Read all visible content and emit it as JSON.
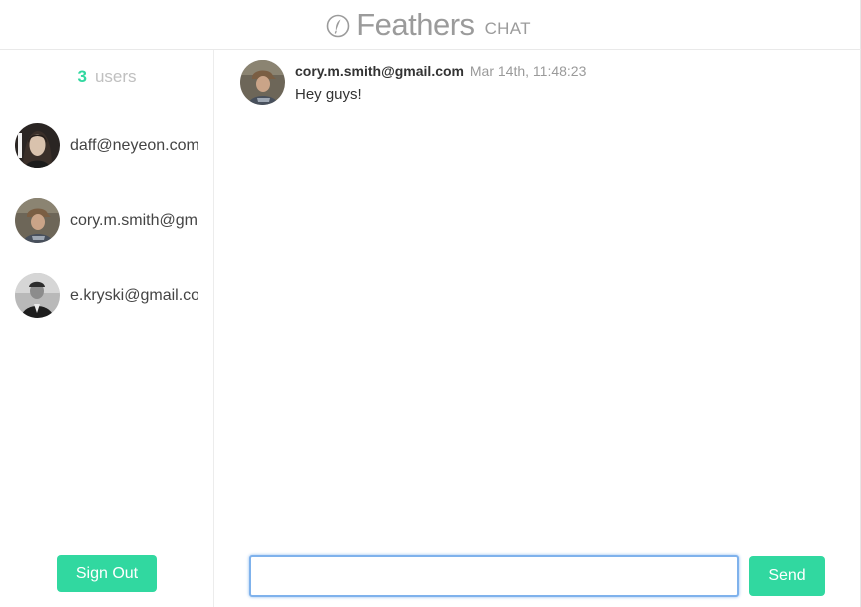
{
  "header": {
    "logo_icon": "feather-icon",
    "title": "Feathers",
    "subtitle": "CHAT"
  },
  "sidebar": {
    "user_count": "3",
    "user_count_label": "users",
    "users": [
      {
        "email": "daff@neyeon.com",
        "avatar": "avatar-long-hair"
      },
      {
        "email": "cory.m.smith@gm",
        "avatar": "avatar-cap"
      },
      {
        "email": "e.kryski@gmail.co",
        "avatar": "avatar-bw"
      }
    ],
    "sign_out_label": "Sign Out"
  },
  "chat": {
    "messages": [
      {
        "author": "cory.m.smith@gmail.com",
        "time": "Mar 14th, 11:48:23",
        "text": "Hey guys!",
        "avatar": "avatar-cap"
      }
    ],
    "composer": {
      "value": "",
      "placeholder": ""
    },
    "send_label": "Send"
  },
  "colors": {
    "accent": "#31d8a0",
    "muted_text": "#9b9b9b",
    "input_focus": "#7fb2ec"
  }
}
